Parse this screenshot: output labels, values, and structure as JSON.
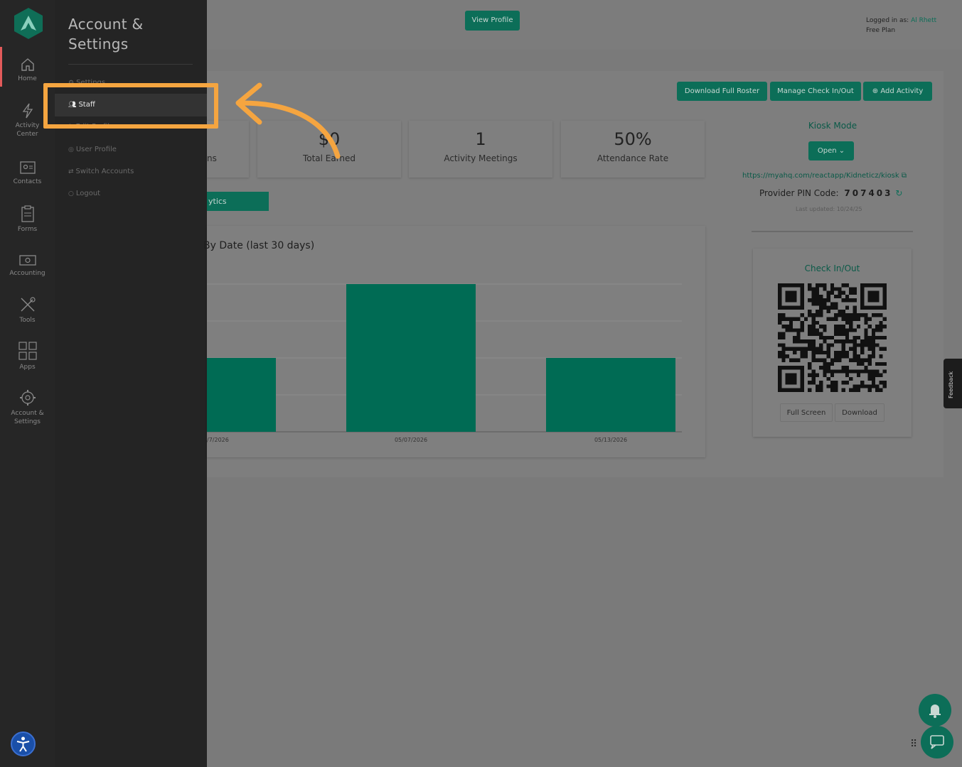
{
  "rail": {
    "items": [
      {
        "label": "Home",
        "icon": "home-icon"
      },
      {
        "label": "Activity Center",
        "icon": "bolt-icon"
      },
      {
        "label": "Contacts",
        "icon": "contacts-icon"
      },
      {
        "label": "Forms",
        "icon": "clipboard-icon"
      },
      {
        "label": "Accounting",
        "icon": "money-icon"
      },
      {
        "label": "Tools",
        "icon": "tools-icon"
      },
      {
        "label": "Apps",
        "icon": "apps-grid-icon"
      },
      {
        "label": "Account & Settings",
        "icon": "gear-icon"
      }
    ]
  },
  "drawer": {
    "title": "Account & Settings",
    "items": [
      {
        "label": "Settings"
      },
      {
        "label": "Staff",
        "active": true
      },
      {
        "label": "Edit Profile"
      },
      {
        "label": "User Profile"
      },
      {
        "label": "Switch Accounts"
      },
      {
        "label": "Logout"
      }
    ]
  },
  "header": {
    "view_profile": "View Profile",
    "logged_in_prefix": "Logged in as:",
    "user_name": "Al Rhett",
    "plan": "Free Plan"
  },
  "actions": {
    "download_roster": "Download Full Roster",
    "manage_checkin": "Manage Check In/Out",
    "add_activity": "Add Activity"
  },
  "stats": [
    {
      "value": "",
      "label": "ns"
    },
    {
      "value": "$0",
      "label": "Total Earned"
    },
    {
      "value": "1",
      "label": "Activity Meetings"
    },
    {
      "value": "50%",
      "label": "Attendance Rate"
    }
  ],
  "analytics_button": "ytics",
  "chart_data": {
    "type": "bar",
    "title": "By Date (last 30 days)",
    "categories": [
      "/7/2026",
      "05/07/2026",
      "05/13/2026"
    ],
    "values": [
      1,
      2,
      1
    ],
    "ylim": [
      0,
      2
    ],
    "grid": true,
    "color": "#006b54"
  },
  "kiosk": {
    "title": "Kiosk Mode",
    "open_label": "Open",
    "url": "https://myahq.com/reactapp/Kidneticz/kiosk",
    "pin_label": "Provider PIN Code:",
    "pin": "707403",
    "last_updated": "Last updated: 10/24/25"
  },
  "checkin": {
    "title": "Check In/Out",
    "full_screen": "Full Screen",
    "download": "Download"
  },
  "feedback": "Feedback",
  "colors": {
    "accent": "#0c6e58",
    "highlight": "#f5a540",
    "rail_bg": "#262626",
    "drawer_bg": "#242424"
  }
}
